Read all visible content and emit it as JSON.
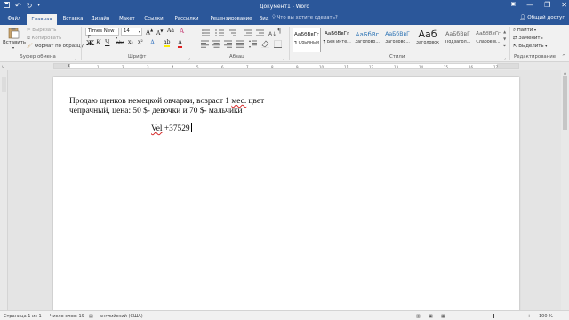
{
  "window": {
    "title": "Документ1 - Word",
    "minimize_glyph": "—",
    "restore_glyph": "❐",
    "close_glyph": "✕"
  },
  "qat": {
    "save_icon": "save-icon",
    "undo_icon": "undo-icon",
    "redo_icon": "redo-icon"
  },
  "tabs": [
    {
      "label": "Файл"
    },
    {
      "label": "Главная"
    },
    {
      "label": "Вставка"
    },
    {
      "label": "Дизайн"
    },
    {
      "label": "Макет"
    },
    {
      "label": "Ссылки"
    },
    {
      "label": "Рассылки"
    },
    {
      "label": "Рецензирование"
    },
    {
      "label": "Вид"
    }
  ],
  "tellme": {
    "label": "Что вы хотите сделать?"
  },
  "share": {
    "label": "Общий доступ"
  },
  "clipboard": {
    "paste_label": "Вставить",
    "cut_label": "Вырезать",
    "copy_label": "Копировать",
    "format_painter_label": "Формат по образцу",
    "group_label": "Буфер обмена"
  },
  "font": {
    "font_name": "Times New F",
    "font_size": "14",
    "grow_label": "A",
    "shrink_label": "A",
    "case_label": "Aa",
    "clear_label": "A",
    "bold_label": "Ж",
    "italic_label": "К",
    "underline_label": "Ч",
    "strike_label": "abc",
    "sub_label": "x₂",
    "sup_label": "x²",
    "effects_label": "A",
    "highlight_label": "ab",
    "color_label": "A",
    "group_label": "Шрифт"
  },
  "paragraph": {
    "group_label": "Абзац",
    "pilcrow": "¶"
  },
  "styles": {
    "group_label": "Стили",
    "items": [
      {
        "preview": "АаБбВвГг",
        "name": "¶ Обычный"
      },
      {
        "preview": "АаБбВвГг",
        "name": "¶ Без инте..."
      },
      {
        "preview": "АаБбВг",
        "name": "Заголово..."
      },
      {
        "preview": "АаБбВвГ",
        "name": "Заголово..."
      },
      {
        "preview": "Ааб",
        "name": "Заголовок"
      },
      {
        "preview": "АаБбВвГ",
        "name": "Подзагол..."
      },
      {
        "preview": "АаБбВвГг",
        "name": "Слабое в..."
      }
    ]
  },
  "editing": {
    "find_label": "Найти",
    "replace_label": "Заменить",
    "select_label": "Выделить",
    "group_label": "Редактирование"
  },
  "ruler": {
    "ticks": [
      "1",
      "2",
      "3",
      "4",
      "5",
      "6",
      "7",
      "8",
      "9",
      "10",
      "11",
      "12",
      "13",
      "14",
      "15",
      "16",
      "17"
    ]
  },
  "document": {
    "line1_a": "Продаю щенков немецкой овчарки, возраст 1 ",
    "line1_typo": "мес.",
    "line1_b": " цвет",
    "line2": "чепрачный, цена: 50 $- девочки и 70 $- мальчики",
    "line3_typo": "Vel",
    "line3_b": " +37529"
  },
  "status": {
    "page": "Страница 1 из 1",
    "words": "Число слов: 19",
    "language": "английский (США)",
    "zoom": "100 %"
  }
}
